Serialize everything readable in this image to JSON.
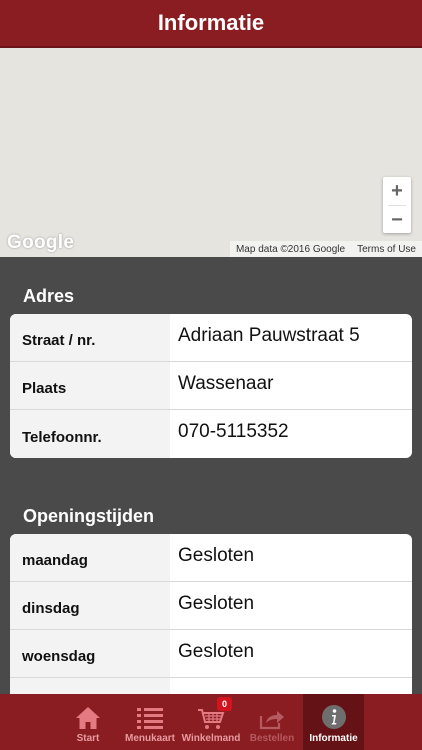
{
  "header": {
    "title": "Informatie"
  },
  "map": {
    "zoom_in": "+",
    "zoom_out": "−",
    "logo": "Google",
    "attribution": "Map data ©2016 Google",
    "terms": "Terms of Use"
  },
  "address": {
    "title": "Adres",
    "rows": [
      {
        "label": "Straat / nr.",
        "value": "Adriaan Pauwstraat 5"
      },
      {
        "label": "Plaats",
        "value": "Wassenaar"
      },
      {
        "label": "Telefoonnr.",
        "value": "070-5115352"
      }
    ]
  },
  "hours": {
    "title": "Openingstijden",
    "rows": [
      {
        "label": "maandag",
        "value": "Gesloten"
      },
      {
        "label": "dinsdag",
        "value": "Gesloten"
      },
      {
        "label": "woensdag",
        "value": "Gesloten"
      }
    ]
  },
  "tabbar": {
    "tabs": [
      {
        "label": "Start",
        "icon": "home-icon"
      },
      {
        "label": "Menukaart",
        "icon": "list-icon"
      },
      {
        "label": "Winkelmand",
        "icon": "cart-icon",
        "badge": "0"
      },
      {
        "label": "Bestellen",
        "icon": "share-icon"
      },
      {
        "label": "Informatie",
        "icon": "info-icon"
      }
    ]
  },
  "colors": {
    "brand": "#8a1d21",
    "active_tab": "#651216",
    "badge": "#d3141f"
  }
}
